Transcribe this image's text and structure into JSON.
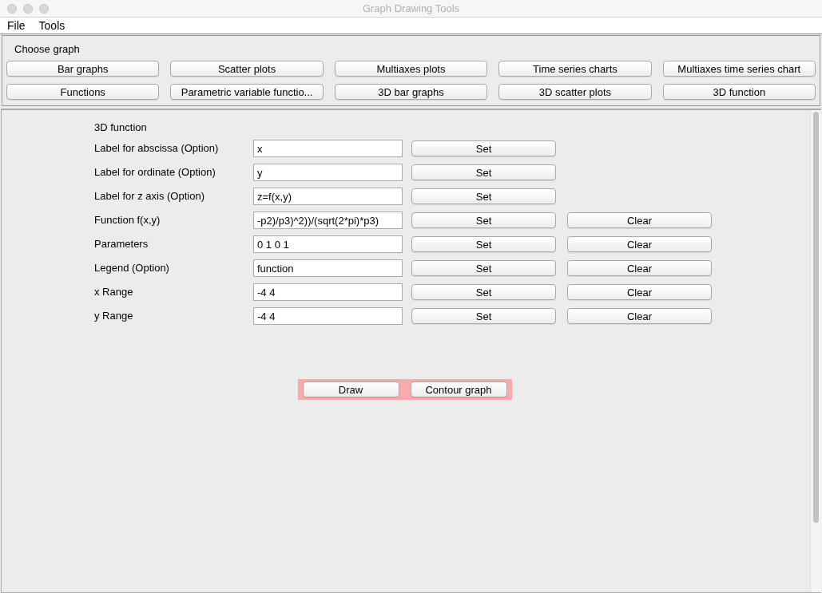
{
  "window": {
    "title": "Graph Drawing Tools"
  },
  "menu": [
    "File",
    "Tools"
  ],
  "choose_graph": {
    "title": "Choose graph",
    "buttons": [
      "Bar graphs",
      "Scatter plots",
      "Multiaxes plots",
      "Time series charts",
      "Multiaxes time series chart",
      "Functions",
      "Parametric variable functio...",
      "3D bar graphs",
      "3D scatter plots",
      "3D function"
    ]
  },
  "form": {
    "title": "3D function",
    "rows": [
      {
        "label": "Label for abscissa (Option)",
        "value": "x",
        "buttons": [
          "Set"
        ]
      },
      {
        "label": "Label for ordinate (Option)",
        "value": "y",
        "buttons": [
          "Set"
        ]
      },
      {
        "label": "Label for z axis (Option)",
        "value": "z=f(x,y)",
        "buttons": [
          "Set"
        ]
      },
      {
        "label": "Function f(x,y)",
        "value": "-p2)/p3)^2))/(sqrt(2*pi)*p3)",
        "buttons": [
          "Set",
          "Clear"
        ]
      },
      {
        "label": "Parameters",
        "value": "0 1 0 1",
        "buttons": [
          "Set",
          "Clear"
        ]
      },
      {
        "label": "Legend (Option)",
        "value": "function",
        "buttons": [
          "Set",
          "Clear"
        ]
      },
      {
        "label": "x Range",
        "value": "-4 4",
        "buttons": [
          "Set",
          "Clear"
        ]
      },
      {
        "label": "y Range",
        "value": "-4 4",
        "buttons": [
          "Set",
          "Clear"
        ]
      }
    ]
  },
  "actions": [
    "Draw",
    "Contour graph"
  ]
}
